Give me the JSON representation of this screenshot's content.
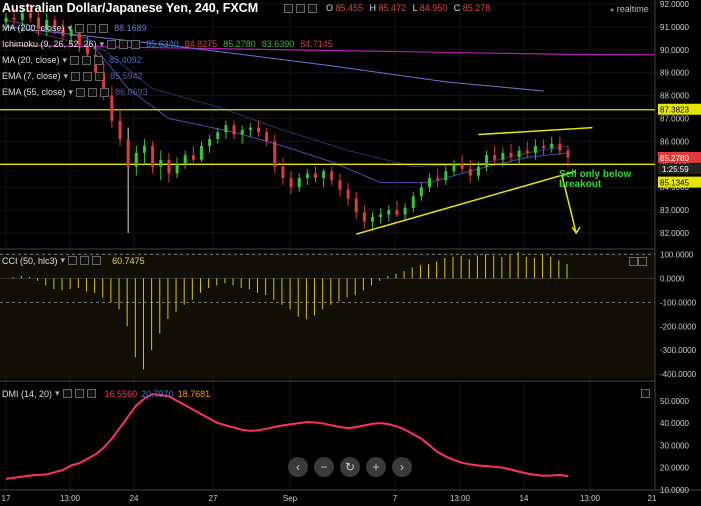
{
  "header": {
    "symbol": "Australian Dollar/Japanese Yen, 240, FXCM",
    "ohlc": [
      {
        "k": "O",
        "v": "85.455"
      },
      {
        "k": "H",
        "v": "85.472"
      },
      {
        "k": "L",
        "v": "84.950"
      },
      {
        "k": "C",
        "v": "85.278"
      }
    ],
    "realtime": "realtime"
  },
  "indicators": [
    {
      "label": "MA (200, close)",
      "values": [
        {
          "v": "88.1689",
          "color": "#6f6fd0"
        }
      ]
    },
    {
      "label": "Ichimoku (9, 26, 52, 26)",
      "values": [
        {
          "v": "85.6340",
          "color": "#3a7fe0"
        },
        {
          "v": "84.8275",
          "color": "#d04040"
        },
        {
          "v": "85.2780",
          "color": "#40b040"
        },
        {
          "v": "83.6390",
          "color": "#40b040"
        },
        {
          "v": "84.7145",
          "color": "#d04040"
        }
      ]
    },
    {
      "label": "MA (20, close)",
      "values": [
        {
          "v": "85.4092",
          "color": "#5c5cc8"
        }
      ]
    },
    {
      "label": "EMA (7, close)",
      "values": [
        {
          "v": "85.5942",
          "color": "#5a5a9a"
        }
      ]
    },
    {
      "label": "EMA (55, close)",
      "values": [
        {
          "v": "86.0693",
          "color": "#5a5a9a"
        }
      ]
    }
  ],
  "annotation": "Sell only below breakout",
  "levels": [
    {
      "price": 87.3823,
      "label": "87.3823",
      "type": "resistance"
    },
    {
      "price": 85.278,
      "label": "85.2780",
      "type": "current"
    },
    {
      "price": 85.1345,
      "label": "85.1345",
      "type": "support"
    }
  ],
  "countdown": "1:25:59",
  "cci_label": "CCI (50, hlc3)",
  "cci_value": "60.7475",
  "dmi_label": "DMI (14, 20)",
  "dmi_values": [
    {
      "v": "16.5560",
      "color": "#ff3060"
    },
    {
      "v": "20.7970",
      "color": "#3a7fe0"
    },
    {
      "v": "18.7681",
      "color": "#ff9900"
    }
  ],
  "nav_buttons": [
    {
      "name": "scroll-left-button",
      "glyph": "‹"
    },
    {
      "name": "zoom-out-button",
      "glyph": "−"
    },
    {
      "name": "reset-chart-button",
      "glyph": "↻"
    },
    {
      "name": "zoom-in-button",
      "glyph": "+"
    },
    {
      "name": "scroll-right-button",
      "glyph": "›"
    }
  ],
  "chart_data": [
    {
      "type": "candlestick",
      "title": "Australian Dollar/Japanese Yen, 240, FXCM",
      "ylim": [
        81.5,
        92.1
      ],
      "y_ticks": [
        "92.0000",
        "91.0000",
        "90.0000",
        "89.0000",
        "88.0000",
        "87.0000",
        "86.0000",
        "85.0000",
        "84.0000",
        "83.0000",
        "82.0000"
      ],
      "x_ticks": [
        "17",
        "13:00",
        "24",
        "27",
        "Sep",
        "7",
        "13:00",
        "14",
        "13:00",
        "21"
      ],
      "candles": [
        [
          91.2,
          91.6,
          90.9,
          91.4
        ],
        [
          91.4,
          91.8,
          91.1,
          91.3
        ],
        [
          91.3,
          91.9,
          90.8,
          91.6
        ],
        [
          91.6,
          92.0,
          91.2,
          91.4
        ],
        [
          91.4,
          91.7,
          90.6,
          90.9
        ],
        [
          90.9,
          91.6,
          90.6,
          91.3
        ],
        [
          91.3,
          91.5,
          90.7,
          91.0
        ],
        [
          91.0,
          91.3,
          90.4,
          90.6
        ],
        [
          90.6,
          91.1,
          90.2,
          90.9
        ],
        [
          90.9,
          91.0,
          89.9,
          90.2
        ],
        [
          90.2,
          90.6,
          89.6,
          89.8
        ],
        [
          89.8,
          90.1,
          88.7,
          89.0
        ],
        [
          89.0,
          89.5,
          87.8,
          88.0
        ],
        [
          88.0,
          88.4,
          86.6,
          86.9
        ],
        [
          86.9,
          87.4,
          85.8,
          86.1
        ],
        [
          86.1,
          86.6,
          82.0,
          84.9
        ],
        [
          84.9,
          85.8,
          84.5,
          85.5
        ],
        [
          85.5,
          86.1,
          85.0,
          85.8
        ],
        [
          85.8,
          86.0,
          84.6,
          84.9
        ],
        [
          84.9,
          85.6,
          84.3,
          85.2
        ],
        [
          85.2,
          85.5,
          84.2,
          84.6
        ],
        [
          84.6,
          85.3,
          84.4,
          85.0
        ],
        [
          85.0,
          85.6,
          84.8,
          85.4
        ],
        [
          85.4,
          85.8,
          85.0,
          85.2
        ],
        [
          85.2,
          86.0,
          85.1,
          85.8
        ],
        [
          85.8,
          86.3,
          85.5,
          86.1
        ],
        [
          86.1,
          86.6,
          85.9,
          86.4
        ],
        [
          86.4,
          86.9,
          86.1,
          86.7
        ],
        [
          86.7,
          86.9,
          86.1,
          86.3
        ],
        [
          86.3,
          86.7,
          85.9,
          86.5
        ],
        [
          86.5,
          86.8,
          86.2,
          86.6
        ],
        [
          86.6,
          86.9,
          86.2,
          86.4
        ],
        [
          86.4,
          86.6,
          85.8,
          86.0
        ],
        [
          86.0,
          86.3,
          84.6,
          84.9
        ],
        [
          84.9,
          85.3,
          84.1,
          84.4
        ],
        [
          84.4,
          84.7,
          83.7,
          84.0
        ],
        [
          84.0,
          84.6,
          83.8,
          84.4
        ],
        [
          84.4,
          84.8,
          84.1,
          84.6
        ],
        [
          84.6,
          84.9,
          84.2,
          84.4
        ],
        [
          84.4,
          84.8,
          84.0,
          84.7
        ],
        [
          84.7,
          84.9,
          84.1,
          84.3
        ],
        [
          84.3,
          84.6,
          83.6,
          83.9
        ],
        [
          83.9,
          84.2,
          83.2,
          83.5
        ],
        [
          83.5,
          83.8,
          82.6,
          82.9
        ],
        [
          82.9,
          83.2,
          82.2,
          82.5
        ],
        [
          82.5,
          82.9,
          82.1,
          82.7
        ],
        [
          82.7,
          83.1,
          82.4,
          82.8
        ],
        [
          82.8,
          83.2,
          82.5,
          83.0
        ],
        [
          83.0,
          83.4,
          82.7,
          82.8
        ],
        [
          82.8,
          83.3,
          82.6,
          83.1
        ],
        [
          83.1,
          83.8,
          82.9,
          83.6
        ],
        [
          83.6,
          84.2,
          83.4,
          84.0
        ],
        [
          84.0,
          84.6,
          83.8,
          84.4
        ],
        [
          84.4,
          84.8,
          84.0,
          84.3
        ],
        [
          84.3,
          84.9,
          84.1,
          84.7
        ],
        [
          84.7,
          85.2,
          84.5,
          85.0
        ],
        [
          85.0,
          85.4,
          84.6,
          84.8
        ],
        [
          84.8,
          85.2,
          84.2,
          84.5
        ],
        [
          84.5,
          85.1,
          84.3,
          84.9
        ],
        [
          84.9,
          85.6,
          84.7,
          85.4
        ],
        [
          85.4,
          85.8,
          85.0,
          85.2
        ],
        [
          85.2,
          85.7,
          84.9,
          85.5
        ],
        [
          85.5,
          85.9,
          85.1,
          85.3
        ],
        [
          85.3,
          85.8,
          85.0,
          85.6
        ],
        [
          85.6,
          86.0,
          85.3,
          85.5
        ],
        [
          85.5,
          86.1,
          85.2,
          85.8
        ],
        [
          85.8,
          86.1,
          85.4,
          85.7
        ],
        [
          85.7,
          86.2,
          85.5,
          85.9
        ],
        [
          85.9,
          86.2,
          85.4,
          85.6
        ],
        [
          85.6,
          85.8,
          84.9,
          85.3
        ]
      ],
      "moving_averages": [
        {
          "name": "MA (200, close)",
          "color": "#7070d8",
          "values": [
            [
              0,
              91.0
            ],
            [
              20,
              90.2
            ],
            [
              40,
              89.3
            ],
            [
              54,
              88.6
            ],
            [
              66,
              88.2
            ]
          ]
        },
        {
          "name": "MA (20, close)",
          "color": "#4848b0",
          "values": [
            [
              0,
              91.3
            ],
            [
              10,
              90.5
            ],
            [
              15,
              88.3
            ],
            [
              20,
              87.0
            ],
            [
              28,
              86.4
            ],
            [
              34,
              85.8
            ],
            [
              40,
              85.1
            ],
            [
              46,
              84.2
            ],
            [
              52,
              84.2
            ],
            [
              58,
              84.8
            ],
            [
              64,
              85.3
            ],
            [
              69,
              85.5
            ]
          ]
        },
        {
          "name": "EMA (55, close)",
          "color": "#303078",
          "values": [
            [
              0,
              91.1
            ],
            [
              12,
              90.0
            ],
            [
              18,
              88.3
            ],
            [
              26,
              87.5
            ],
            [
              34,
              86.5
            ],
            [
              42,
              85.6
            ],
            [
              50,
              84.9
            ],
            [
              58,
              85.0
            ],
            [
              64,
              85.5
            ],
            [
              69,
              85.8
            ]
          ]
        }
      ],
      "ichimoku_cloud_line": {
        "color": "#b020b0",
        "values": [
          [
            0,
            90.2
          ],
          [
            69,
            89.8
          ]
        ]
      },
      "trendlines": [
        {
          "from": [
            43,
            81.95
          ],
          "to": [
            70,
            84.7
          ]
        },
        {
          "from": [
            58,
            86.3
          ],
          "to": [
            72,
            86.6
          ]
        }
      ],
      "arrow_target": 82.0
    },
    {
      "type": "bar",
      "title": "CCI (50, hlc3)",
      "ylim": [
        -420,
        110
      ],
      "y_ticks": [
        "100.0000",
        "0.0000",
        "-100.0000",
        "-200.0000",
        "-300.0000",
        "-400.0000"
      ],
      "reference_lines": [
        100,
        -100
      ],
      "values": [
        0,
        5,
        10,
        6,
        -10,
        -30,
        -45,
        -50,
        -45,
        -40,
        -55,
        -60,
        -80,
        -100,
        -130,
        -200,
        -330,
        -380,
        -300,
        -230,
        -170,
        -140,
        -110,
        -90,
        -60,
        -40,
        -30,
        -20,
        -30,
        -40,
        -45,
        -60,
        -70,
        -90,
        -110,
        -130,
        -160,
        -170,
        -155,
        -130,
        -110,
        -95,
        -80,
        -70,
        -50,
        -30,
        -10,
        10,
        20,
        30,
        45,
        55,
        60,
        70,
        85,
        90,
        95,
        80,
        95,
        100,
        95,
        90,
        100,
        110,
        90,
        85,
        100,
        90,
        75,
        60
      ]
    },
    {
      "type": "line",
      "title": "DMI (14, 20)",
      "ylim": [
        10,
        58
      ],
      "y_ticks": [
        "50.0000",
        "40.0000",
        "30.0000",
        "20.0000",
        "10.0000"
      ],
      "series": [
        {
          "name": "16.5560",
          "color": "#ff3060",
          "values": [
            15,
            15.5,
            16,
            16.5,
            16.8,
            17,
            18,
            19,
            21,
            22,
            24,
            26,
            29,
            33,
            38,
            43,
            48,
            51,
            53,
            52.5,
            52,
            50,
            48,
            46,
            44,
            42,
            40,
            39,
            38,
            37,
            36.5,
            36.8,
            37.5,
            38.3,
            39,
            39.5,
            40,
            40.5,
            40.3,
            39.8,
            39,
            38.2,
            37.8,
            38.2,
            39,
            39.7,
            40,
            39.5,
            38.5,
            37,
            35,
            33,
            30,
            27,
            25,
            23.5,
            22.2,
            21.5,
            21,
            20.7,
            20.4,
            20,
            19.2,
            18.2,
            17.4,
            16.8,
            16.4,
            16.5,
            16.7,
            16.2
          ]
        }
      ]
    }
  ]
}
